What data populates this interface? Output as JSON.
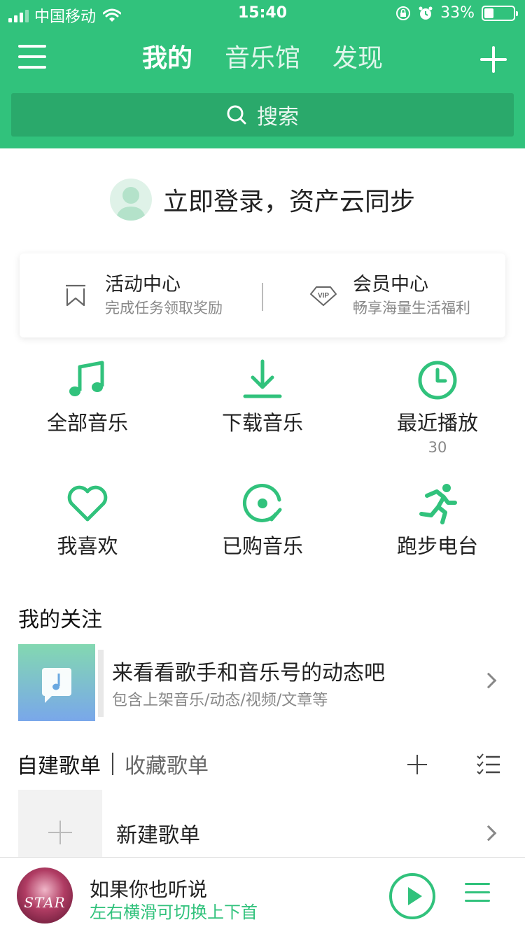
{
  "status_bar": {
    "carrier": "中国移动",
    "time": "15:40",
    "battery": "33%",
    "battery_level": 0.33
  },
  "header": {
    "tabs": [
      {
        "label": "我的",
        "active": true
      },
      {
        "label": "音乐馆",
        "active": false
      },
      {
        "label": "发现",
        "active": false
      }
    ],
    "search_placeholder": "搜索"
  },
  "login": {
    "text": "立即登录，资产云同步"
  },
  "activity_card": {
    "left": {
      "title": "活动中心",
      "subtitle": "完成任务领取奖励",
      "icon": "bookmark-icon"
    },
    "right": {
      "title": "会员中心",
      "subtitle": "畅享海量生活福利",
      "icon": "vip-icon"
    }
  },
  "shortcuts": [
    {
      "label": "全部音乐",
      "icon": "music-note-icon"
    },
    {
      "label": "下载音乐",
      "icon": "download-icon"
    },
    {
      "label": "最近播放",
      "icon": "clock-icon",
      "count": "30"
    },
    {
      "label": "我喜欢",
      "icon": "heart-icon"
    },
    {
      "label": "已购音乐",
      "icon": "purchased-disc-icon"
    },
    {
      "label": "跑步电台",
      "icon": "runner-icon"
    }
  ],
  "follow": {
    "section_title": "我的关注",
    "title": "来看看歌手和音乐号的动态吧",
    "subtitle": "包含上架音乐/动态/视频/文章等"
  },
  "playlists": {
    "tabs": [
      {
        "label": "自建歌单",
        "active": true
      },
      {
        "label": "收藏歌单",
        "active": false
      }
    ],
    "new_playlist_label": "新建歌单"
  },
  "player": {
    "title": "如果你也听说",
    "hint": "左右横滑可切换上下首",
    "cover_text": "STAR"
  },
  "colors": {
    "brand_green": "#31c27c",
    "search_bg": "#2aa96b"
  }
}
